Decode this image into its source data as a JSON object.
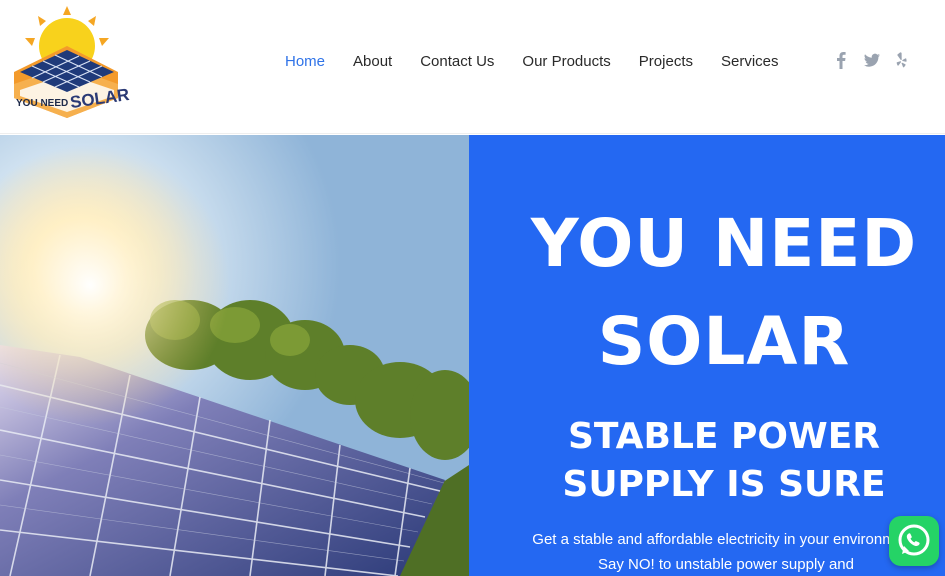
{
  "logo": {
    "line1": "YOU NEED",
    "line2": "SOLAR"
  },
  "nav": {
    "items": [
      {
        "label": "Home",
        "active": true
      },
      {
        "label": "About",
        "active": false
      },
      {
        "label": "Contact Us",
        "active": false
      },
      {
        "label": "Our Products",
        "active": false
      },
      {
        "label": "Projects",
        "active": false
      },
      {
        "label": "Services",
        "active": false
      }
    ]
  },
  "social": {
    "icons": [
      {
        "name": "facebook-icon",
        "glyph": "f"
      },
      {
        "name": "twitter-icon",
        "glyph": "t"
      },
      {
        "name": "yelp-icon",
        "glyph": "y"
      }
    ],
    "color": "#9aa3b0"
  },
  "hero": {
    "title_line1": "YOU NEED",
    "title_line2": "SOLAR",
    "subtitle_line1": "STABLE POWER",
    "subtitle_line2": "SUPPLY IS SURE",
    "description": "Get a stable and affordable electricity in your environment. Say NO! to unstable power supply and",
    "panel_color": "#2468f2"
  },
  "whatsapp": {
    "icon": "whatsapp-icon",
    "color": "#25d366"
  },
  "colors": {
    "accent": "#2f73e8",
    "nav_text": "#2a2a2a"
  }
}
